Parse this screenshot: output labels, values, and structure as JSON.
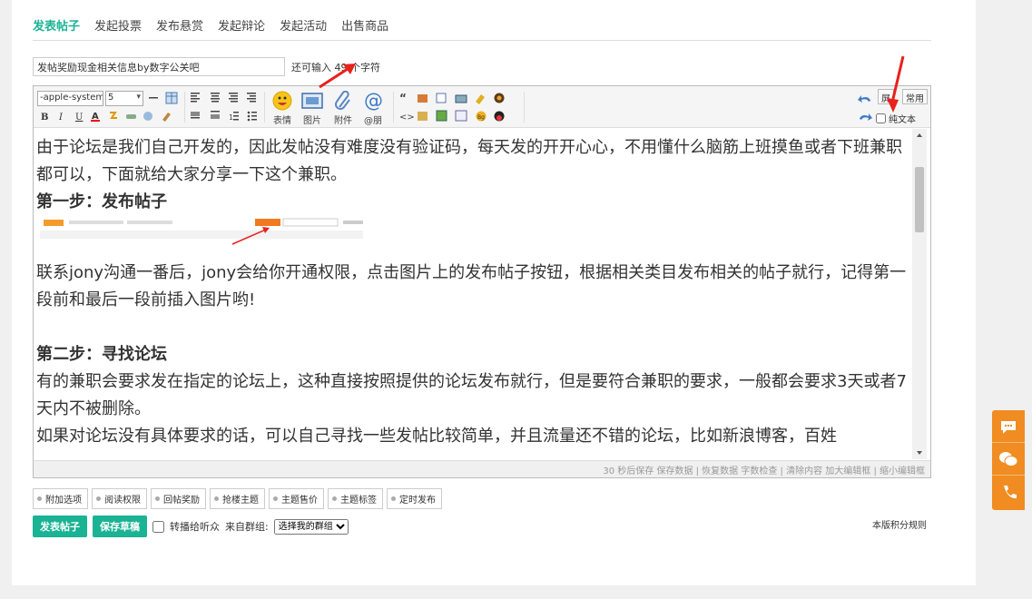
{
  "tabs": [
    "发表帖子",
    "发起投票",
    "发布悬赏",
    "发起辩论",
    "发起活动",
    "出售商品"
  ],
  "subject": {
    "value": "发帖奖励现金相关信息by数字公关吧",
    "remain_text": "还可输入 49 个字符"
  },
  "toolbar": {
    "font": "-apple-system",
    "size": "5",
    "emoji_label": "表情",
    "image_label": "图片",
    "attach_label": "附件",
    "at_label": "@朋",
    "fullscreen_label": "屏",
    "common_label": "常用",
    "plaintext_label": "纯文本"
  },
  "content": {
    "para1": "由于论坛是我们自己开发的，因此发帖没有难度没有验证码，每天发的开开心心，不用懂什么脑筋上班摸鱼或者下班兼职都可以，下面就给大家分享一下这个兼职。",
    "step1_title": "第一步：发布帖子",
    "para2": "联系jony沟通一番后，jony会给你开通权限，点击图片上的发布帖子按钮，根据相关类目发布相关的帖子就行，记得第一段前和最后一段前插入图片哟!",
    "step2_title": "第二步：寻找论坛",
    "para3": "有的兼职会要求发在指定的论坛上，这种直接按照提供的论坛发布就行，但是要符合兼职的要求，一般都会要求3天或者7天内不被删除。",
    "para4": "如果对论坛没有具体要求的话，可以自己寻找一些发帖比较简单，并且流量还不错的论坛，比如新浪博客，百姓"
  },
  "status_bar": "30 秒后保存 保存数据 | 恢复数据    字数检查 | 清除内容    加大编辑框 | 缩小编辑框",
  "options": [
    "附加选项",
    "阅读权限",
    "回帖奖励",
    "抢楼主题",
    "主题售价",
    "主题标签",
    "定时发布"
  ],
  "actions": {
    "post": "发表帖子",
    "save_draft": "保存草稿",
    "forward_label": "转播给听众",
    "group_label": "来自群组:",
    "group_select": "选择我的群组",
    "rules": "本版积分规则"
  },
  "colors": {
    "accent": "#1ab394",
    "side": "#f08c21",
    "arrow": "#e8221c"
  }
}
